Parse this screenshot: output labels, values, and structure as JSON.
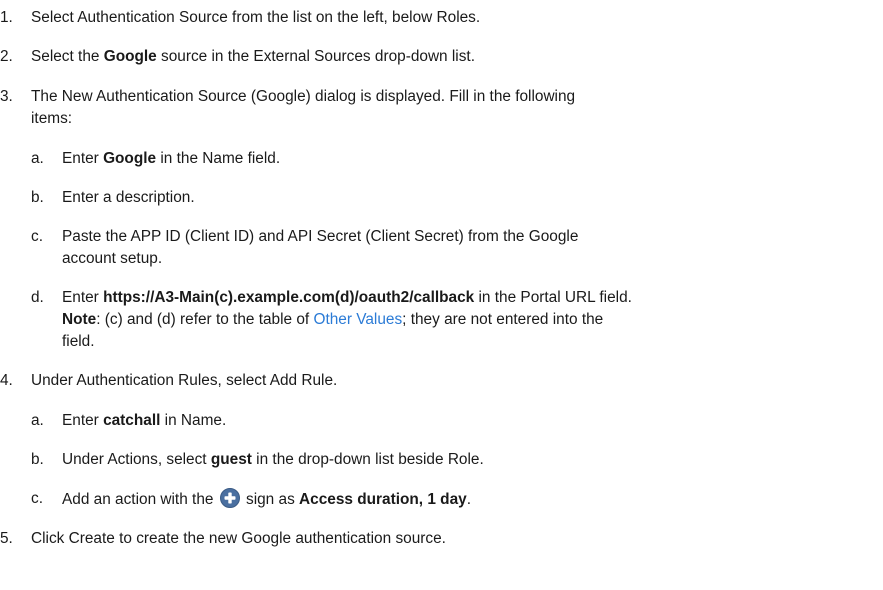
{
  "steps": [
    {
      "num": "1.",
      "lines": [
        [
          "Select Authentication Source from the list on the left, below Roles."
        ]
      ]
    },
    {
      "num": "2.",
      "lines": [
        [
          "Select the ",
          {
            "b": "Google"
          },
          " source in the External Sources drop-down list."
        ]
      ]
    },
    {
      "num": "3.",
      "lines": [
        [
          "The New Authentication Source (Google) dialog is displayed. Fill in the following"
        ],
        [
          "items:"
        ]
      ],
      "subs": [
        {
          "num": "a.",
          "lines": [
            [
              "Enter ",
              {
                "b": "Google"
              },
              " in the Name field."
            ]
          ]
        },
        {
          "num": "b.",
          "lines": [
            [
              "Enter a description."
            ]
          ]
        },
        {
          "num": "c.",
          "lines": [
            [
              "Paste the APP ID (Client ID) and API Secret (Client Secret) from the Google"
            ],
            [
              "account setup."
            ]
          ]
        },
        {
          "num": "d.",
          "lines": [
            [
              "Enter ",
              {
                "b": "https://A3-Main(c).example.com(d)/oauth2/callback"
              },
              " in the Portal URL field."
            ],
            [
              {
                "b": "Note"
              },
              ": (c) and (d) refer to the table of ",
              {
                "link": "Other Values"
              },
              "; they are not entered into the"
            ],
            [
              "field."
            ]
          ]
        }
      ]
    },
    {
      "num": "4.",
      "lines": [
        [
          "Under Authentication Rules, select Add Rule."
        ]
      ],
      "subs": [
        {
          "num": "a.",
          "lines": [
            [
              "Enter ",
              {
                "b": "catchall"
              },
              " in Name."
            ]
          ]
        },
        {
          "num": "b.",
          "lines": [
            [
              "Under Actions, select ",
              {
                "b": "guest"
              },
              " in the drop-down list beside Role."
            ]
          ]
        },
        {
          "num": "c.",
          "lines": [
            [
              "Add an action with the ",
              {
                "icon": "plus-circle-icon"
              },
              " sign as ",
              {
                "b": "Access duration, 1 day"
              },
              "."
            ]
          ]
        }
      ]
    },
    {
      "num": "5.",
      "lines": [
        [
          "Click Create to create the new Google authentication source."
        ]
      ]
    }
  ],
  "colors": {
    "link": "#2b7bd6",
    "icon_fill": "#4a6fa0",
    "icon_plus": "#ffffff"
  }
}
